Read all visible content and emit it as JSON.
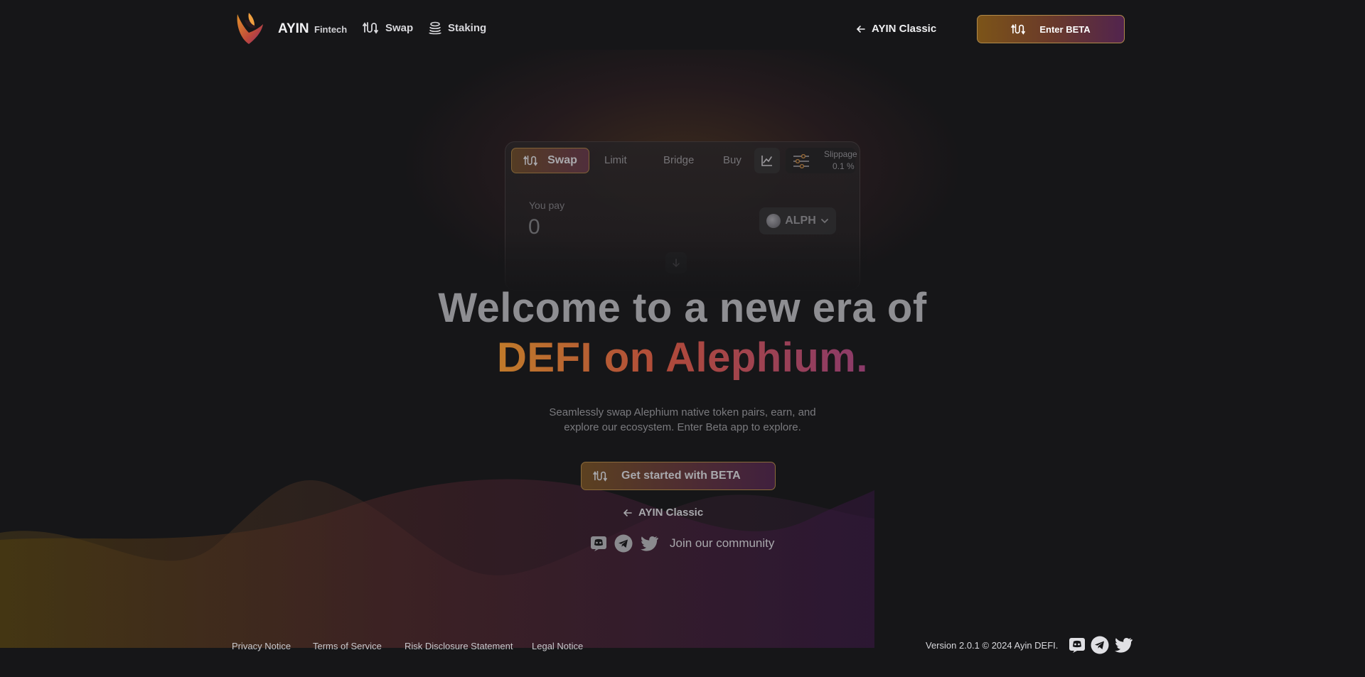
{
  "header": {
    "brand": "AYIN",
    "brand_sub": "Fintech",
    "nav": [
      {
        "label": "Swap",
        "icon": "swap-icon"
      },
      {
        "label": "Staking",
        "icon": "coins-icon"
      }
    ],
    "classic_link": "AYIN Classic",
    "beta_button": "Enter BETA"
  },
  "swap_card": {
    "tabs": [
      {
        "label": "Swap",
        "active": true
      },
      {
        "label": "Limit",
        "active": false
      },
      {
        "label": "Bridge",
        "active": false
      },
      {
        "label": "Buy",
        "active": false
      }
    ],
    "slippage_label": "Slippage",
    "slippage_value": "0.1 %",
    "pay_label": "You pay",
    "pay_value": "0",
    "token": "ALPH"
  },
  "hero": {
    "line1": "Welcome to a new era of",
    "line2": "DEFI on Alephium.",
    "subtitle_line1": "Seamlessly swap Alephium native token pairs, earn, and",
    "subtitle_line2": "explore our ecosystem. Enter Beta app to explore.",
    "cta": "Get started with BETA",
    "classic_link": "AYIN Classic",
    "community_text": "Join our community"
  },
  "footer": {
    "links": [
      "Privacy Notice",
      "Terms of Service",
      "Risk Disclosure Statement",
      "Legal Notice"
    ],
    "version": "Version 2.0.1 © 2024 Ayin DEFI."
  },
  "colors": {
    "background": "#161618",
    "accent_gold": "#c07a2a",
    "accent_red": "#b04a3a",
    "accent_purple": "#8a3a6a"
  }
}
